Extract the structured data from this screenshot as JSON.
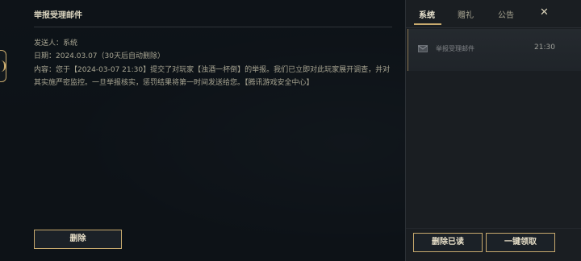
{
  "detail": {
    "title": "举报受理邮件",
    "sender": "发送人：系统",
    "date": "日期：2024.03.07（30天后自动删除）",
    "content": "内容：您于【2024-03-07 21:30】提交了对玩家【浊酒一杯倒】的举报。我们已立即对此玩家展开调查，并对其实施严密监控。一旦举报核实，惩罚结果将第一时间发送给您。【腾讯游戏安全中心】",
    "delete_button": "删除"
  },
  "tabs": [
    {
      "label": "系统",
      "active": true
    },
    {
      "label": "赠礼",
      "active": false
    },
    {
      "label": "公告",
      "active": false
    }
  ],
  "close_icon": "close-icon",
  "mail_list": [
    {
      "icon": "mail-icon",
      "name": "举报受理邮件",
      "time": "21:30",
      "selected": true
    }
  ],
  "footer": {
    "delete_read": "删除已读",
    "claim_all": "一键领取"
  },
  "colors": {
    "accent_gold": "#c8aa6e",
    "panel_dark": "#0e1318",
    "sidebar_bg": "#1a1e22"
  }
}
